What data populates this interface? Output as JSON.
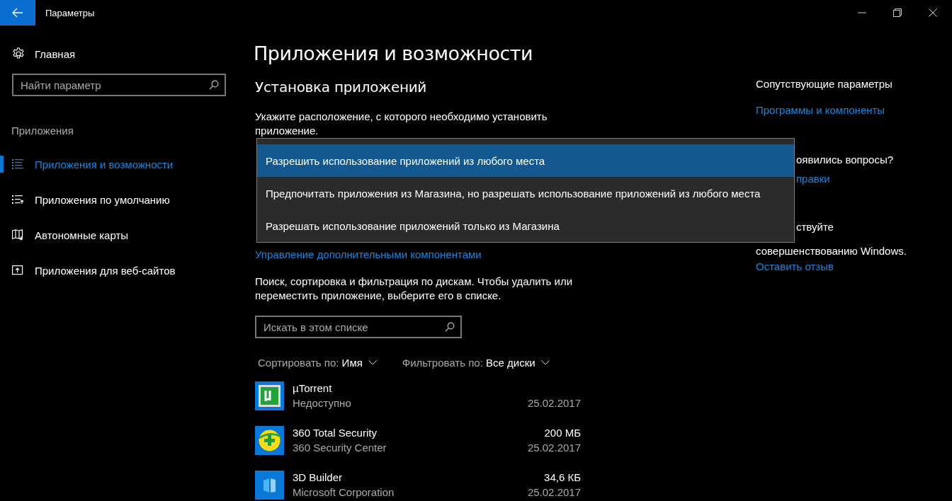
{
  "window": {
    "title": "Параметры"
  },
  "sidebar": {
    "home": "Главная",
    "search": {
      "placeholder": "Найти параметр"
    },
    "section": "Приложения",
    "items": [
      {
        "label": "Приложения и возможности",
        "selected": true
      },
      {
        "label": "Приложения по умолчанию",
        "selected": false
      },
      {
        "label": "Автономные карты",
        "selected": false
      },
      {
        "label": "Приложения для веб-сайтов",
        "selected": false
      }
    ]
  },
  "main": {
    "title": "Приложения и возможности",
    "install_heading": "Установка приложений",
    "install_prompt": "Укажите расположение, с которого необходимо установить приложение.",
    "dropdown": {
      "options": [
        {
          "label": "Разрешить использование приложений из любого места",
          "selected": true
        },
        {
          "label": "Предпочитать приложения из Магазина, но разрешать использование приложений из любого места",
          "selected": false
        },
        {
          "label": "Разрешать использование приложений только из Магазина",
          "selected": false
        }
      ]
    },
    "manage_link": "Управление дополнительными компонентами",
    "search_hint": "Поиск, сортировка и фильтрация по дискам. Чтобы удалить или переместить приложение, выберите его в списке.",
    "search": {
      "placeholder": "Искать в этом списке"
    },
    "sort": {
      "label": "Сортировать по:",
      "value": "Имя"
    },
    "filter": {
      "label": "Фильтровать по:",
      "value": "Все диски"
    },
    "apps": [
      {
        "name": "µTorrent",
        "publisher": "Недоступно",
        "date": "25.02.2017"
      },
      {
        "name": "360 Total Security",
        "publisher": "360 Security Center",
        "size": "200 МБ",
        "date": "25.02.2017"
      },
      {
        "name": "3D Builder",
        "publisher": "Microsoft Corporation",
        "size": "34,6 КБ",
        "date": "25.02.2017"
      }
    ]
  },
  "related": {
    "heading": "Сопутствующие параметры",
    "link": "Программы и компоненты",
    "question": "оявились вопросы?",
    "help_link": "правки",
    "feedback_text": "ствуйте",
    "feedback_text_2": "совершенствованию Windows.",
    "feedback_link": "Оставить отзыв"
  }
}
